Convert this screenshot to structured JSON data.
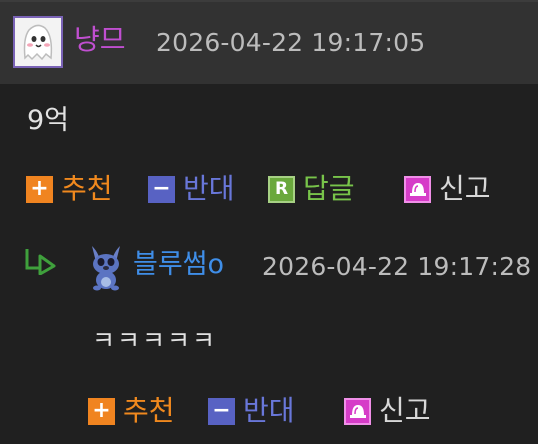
{
  "comment": {
    "author": "냥므",
    "timestamp": "2026-04-22 19:17:05",
    "body": "9억",
    "actions": {
      "recommend": "추천",
      "oppose": "반대",
      "reply": "답글",
      "report": "신고"
    }
  },
  "reply": {
    "author": "블루썸o",
    "timestamp": "2026-04-22 19:17:28",
    "body": "ㅋㅋㅋㅋㅋ",
    "actions": {
      "recommend": "추천",
      "oppose": "반대",
      "report": "신고"
    }
  },
  "icons": {
    "recommend": "plus-icon",
    "oppose": "minus-icon",
    "reply": "r-icon",
    "report": "siren-icon",
    "reply_marker": "reply-arrow-icon"
  },
  "colors": {
    "background": "#202020",
    "header": "#323232",
    "author1": "#c04fd0",
    "author2": "#3f8ee8",
    "recommend": "#f08420",
    "oppose": "#5862c3",
    "reply": "#6aa83c",
    "report": "#d63cc8"
  }
}
